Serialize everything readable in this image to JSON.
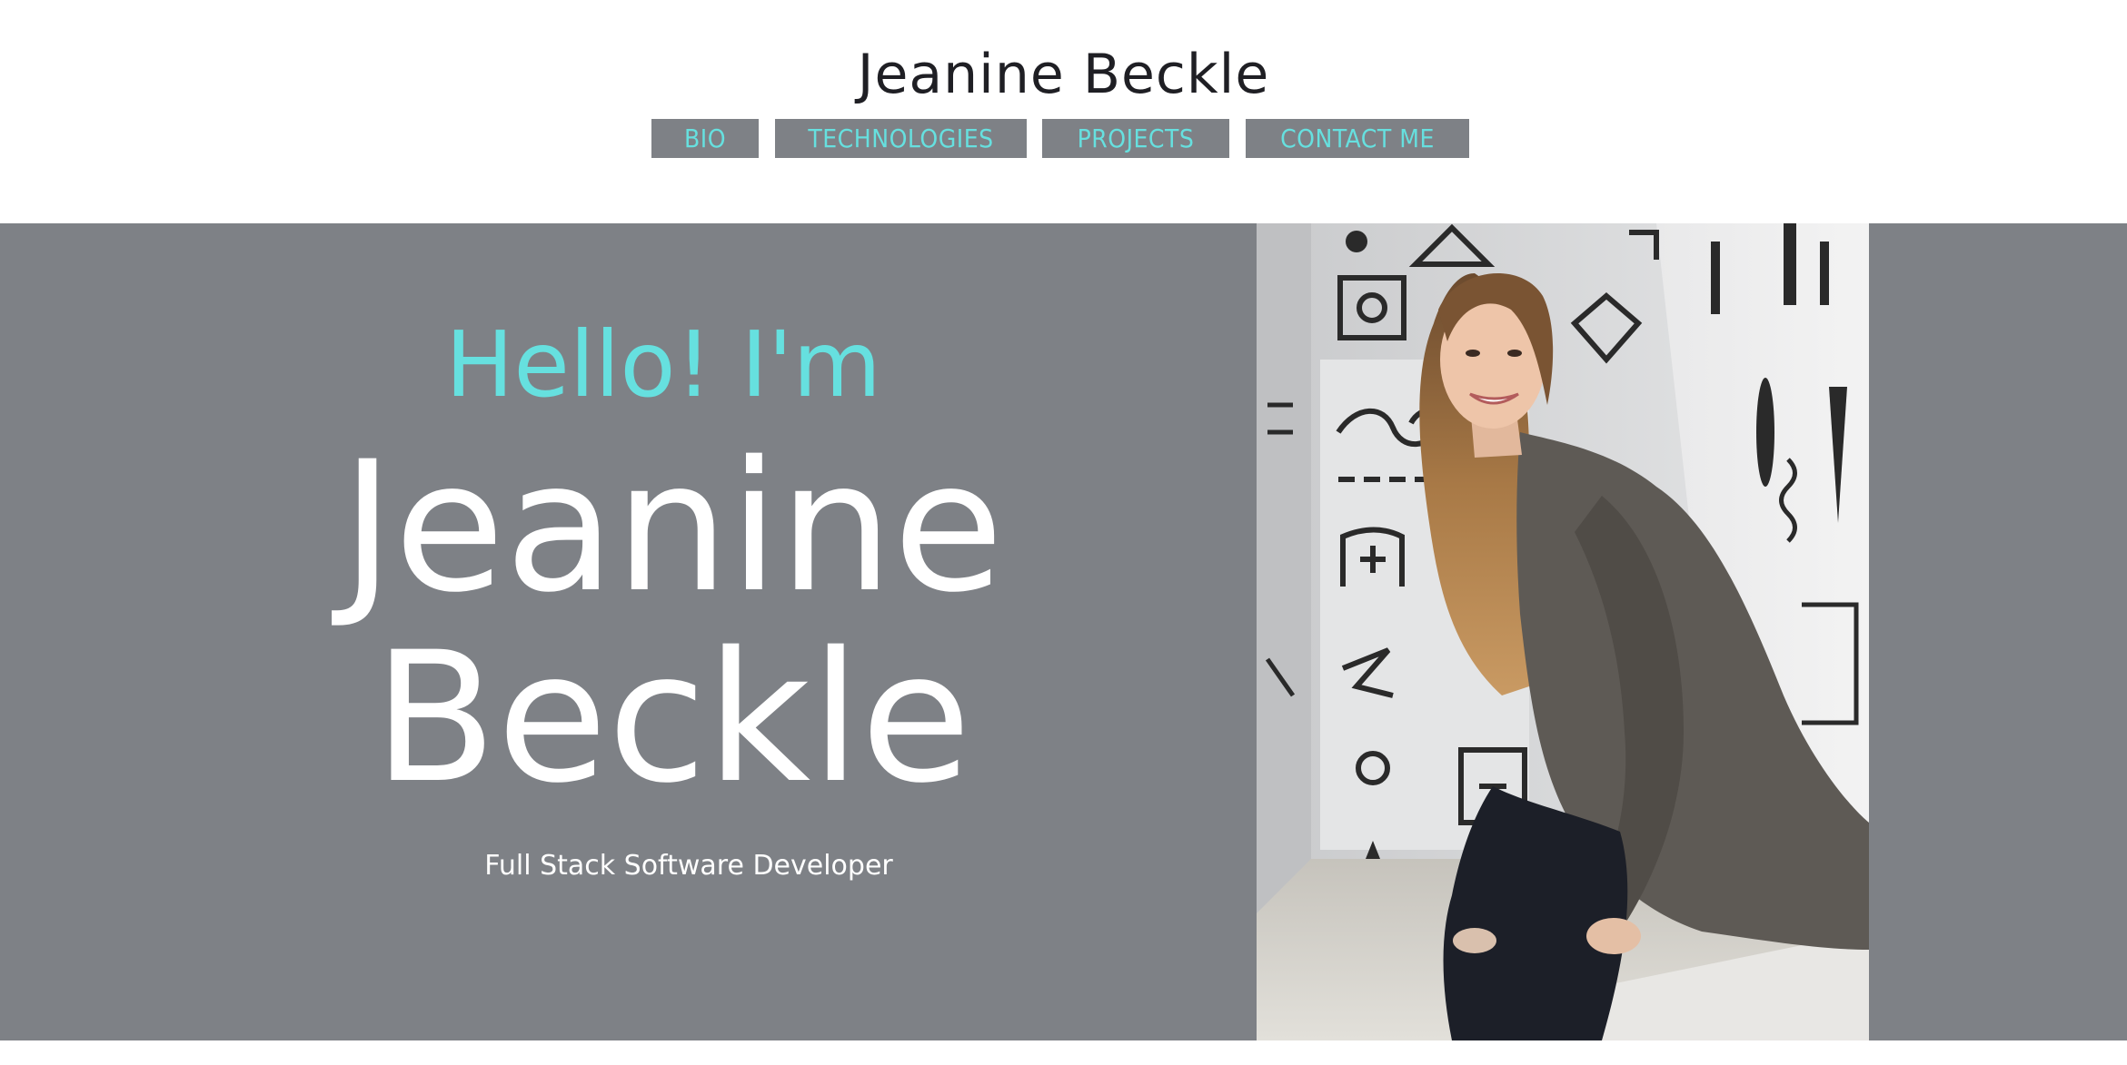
{
  "header": {
    "site_title": "Jeanine Beckle",
    "nav": [
      {
        "label": "BIO"
      },
      {
        "label": "TECHNOLOGIES"
      },
      {
        "label": "PROJECTS"
      },
      {
        "label": "CONTACT ME"
      }
    ]
  },
  "hero": {
    "greeting": "Hello! I'm",
    "first_name": "Jeanine",
    "last_name": "Beckle",
    "subtitle": "Full Stack Software Developer"
  },
  "colors": {
    "accent": "#66e0df",
    "hero_background": "#7e8186",
    "title_text": "#1f1f24",
    "hero_text": "#ffffff"
  }
}
